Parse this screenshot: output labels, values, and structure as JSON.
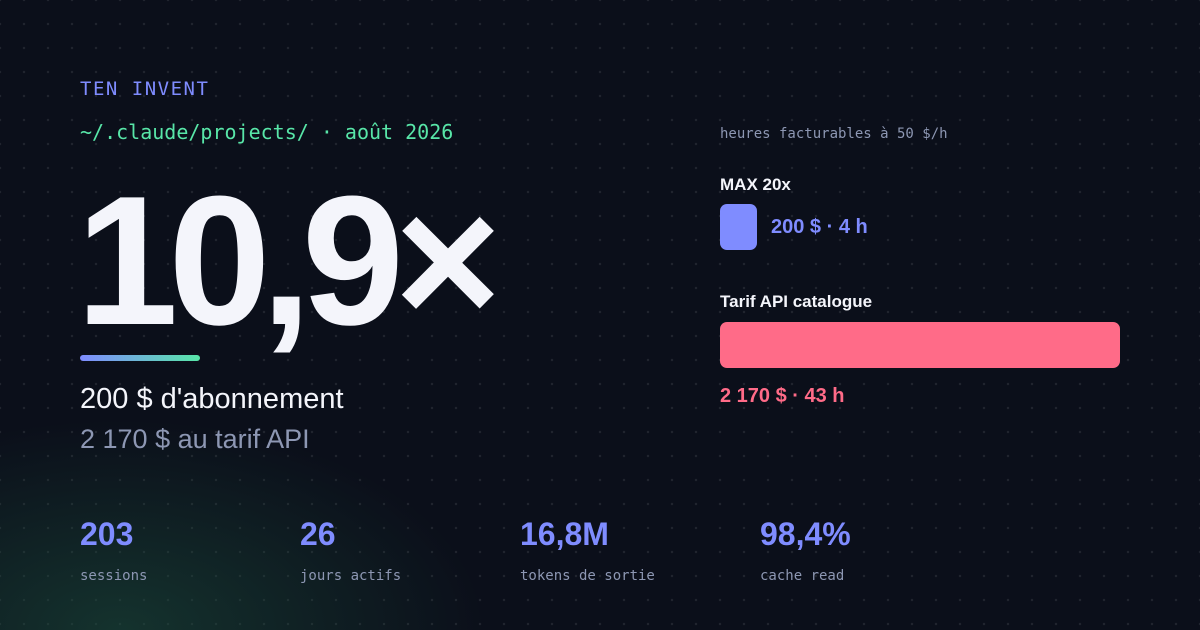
{
  "brand": "TEN INVENT",
  "path_line": "~/.claude/projects/ · août 2026",
  "multiplier": "10,9×",
  "subscription_text": "200 $ d'abonnement",
  "api_price_text": "2 170 $ au tarif API",
  "comparison": {
    "caption": "heures facturables à 50 $/h",
    "plan": {
      "label": "MAX 20x",
      "value_text": "200 $ · 4 h",
      "hours": 4,
      "color": "#7f8cff"
    },
    "api": {
      "label": "Tarif API catalogue",
      "value_text": "2 170 $ · 43 h",
      "hours": 43,
      "color": "#ff6b88"
    }
  },
  "stats": [
    {
      "value": "203",
      "label": "sessions"
    },
    {
      "value": "26",
      "label": "jours actifs"
    },
    {
      "value": "16,8M",
      "label": "tokens de sortie"
    },
    {
      "value": "98,4%",
      "label": "cache read"
    }
  ],
  "colors": {
    "accent": "#7f8cff",
    "green": "#58e6a8",
    "pink": "#ff6b88",
    "background": "#0b0f1a"
  }
}
